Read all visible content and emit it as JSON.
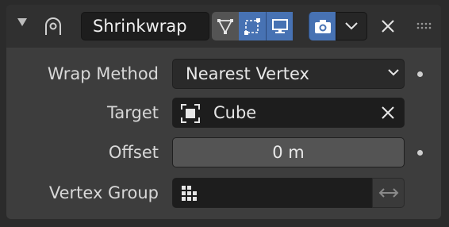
{
  "header": {
    "modifier_name": "Shrinkwrap",
    "icons": [
      "collapse-arrow",
      "shrinkwrap-modifier-icon",
      "edit-cage-icon",
      "edit-mode-icon",
      "viewport-display-icon",
      "render-camera-icon",
      "chevron-down-icon",
      "close-icon",
      "drag-handle-icon"
    ]
  },
  "fields": {
    "wrap_method": {
      "label": "Wrap Method",
      "value": "Nearest Vertex"
    },
    "target": {
      "label": "Target",
      "value": "Cube"
    },
    "offset": {
      "label": "Offset",
      "value": "0 m"
    },
    "vertex_group": {
      "label": "Vertex Group",
      "value": ""
    }
  },
  "colors": {
    "panel_bg": "#3d3d3d",
    "header_bg": "#303030",
    "accent_blue": "#4772b3",
    "field_dark": "#1d1d1d",
    "slider_gray": "#545454"
  }
}
